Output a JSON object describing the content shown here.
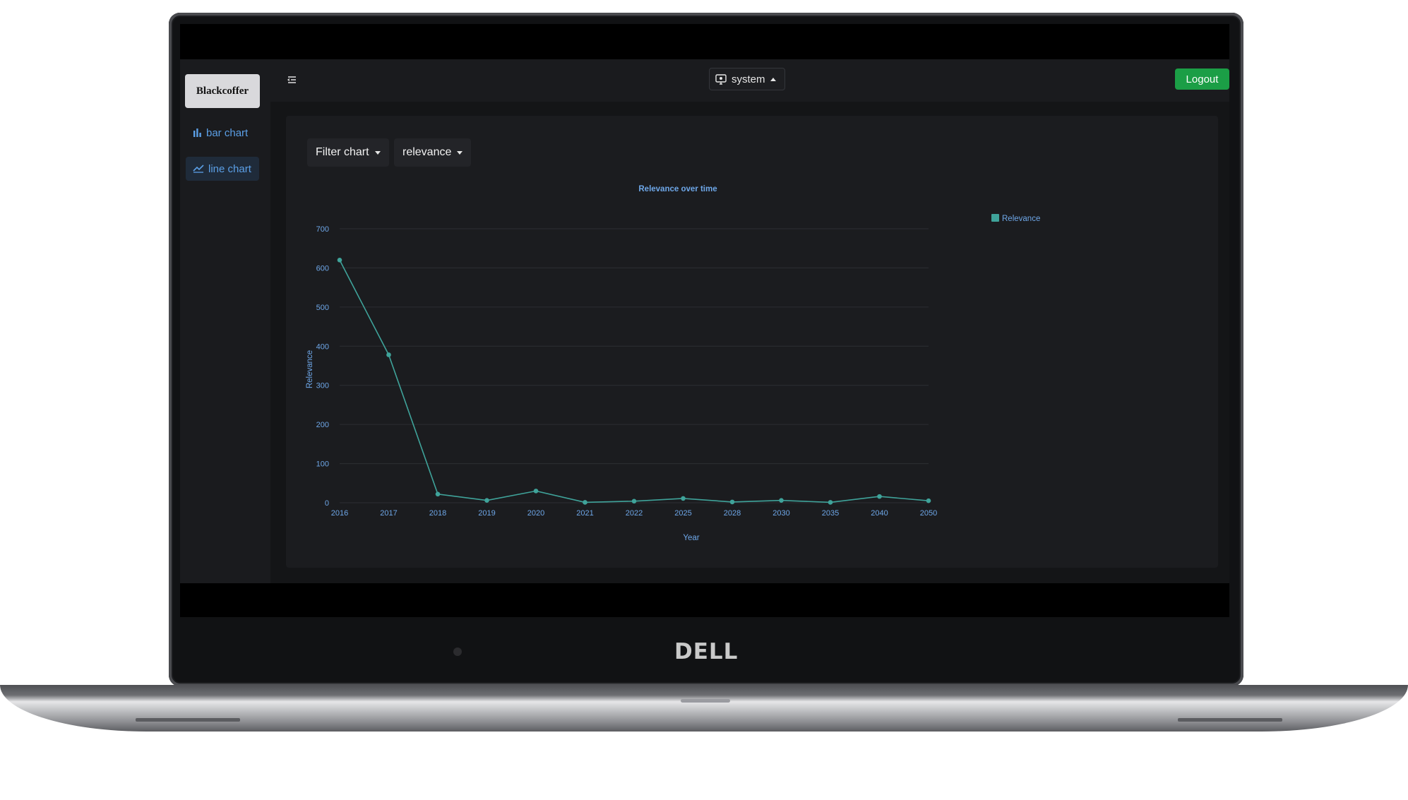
{
  "sidebar": {
    "brand": "Blackcoffer",
    "items": [
      {
        "label": "bar chart",
        "icon": "bar-chart-icon"
      },
      {
        "label": "line chart",
        "icon": "line-chart-icon"
      }
    ]
  },
  "header": {
    "theme_select": "system",
    "logout_label": "Logout"
  },
  "filters": {
    "chart_filter": "Filter chart",
    "metric": "relevance"
  },
  "device": {
    "brand": "DELL"
  },
  "colors": {
    "accent": "#5b9fe6",
    "series": "#3fa39a",
    "logout": "#1b9e46"
  },
  "chart_data": {
    "type": "line",
    "title": "Relevance over time",
    "xlabel": "Year",
    "ylabel": "Relevance",
    "categories": [
      "2016",
      "2017",
      "2018",
      "2019",
      "2020",
      "2021",
      "2022",
      "2025",
      "2028",
      "2030",
      "2035",
      "2040",
      "2050"
    ],
    "series": [
      {
        "name": "Relevance",
        "values": [
          620,
          378,
          22,
          6,
          30,
          1,
          4,
          11,
          2,
          6,
          1,
          16,
          5
        ]
      }
    ],
    "ylim": [
      0,
      700
    ],
    "yticks": [
      0,
      100,
      200,
      300,
      400,
      500,
      600,
      700
    ],
    "grid": true,
    "legend": "top-right"
  }
}
